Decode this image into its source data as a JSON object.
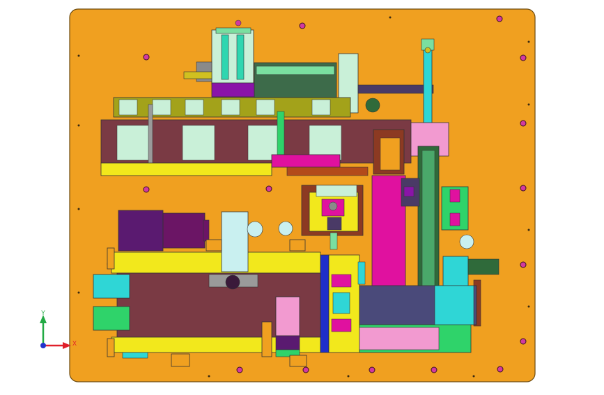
{
  "viewport": {
    "title": "",
    "colors": {
      "background": "#ffffff",
      "plate": "#f0a020",
      "plate_edge": "#6b4a10",
      "yellow": "#f2e81c",
      "magenta": "#e0119f",
      "purple": "#6b1565",
      "cyan": "#2fd6d6",
      "blue": "#1f2ec9",
      "green": "#2fd36a",
      "olive": "#a3a21a",
      "brown": "#8c3a22",
      "pink": "#f29ad0",
      "maroon": "#7a3a44"
    },
    "triad": {
      "x_label": "X",
      "y_label": "Y",
      "x_color": "#e0202a",
      "y_color": "#22aa44",
      "origin_color": "#2233cc",
      "icon": "coordinate-triad-icon"
    }
  }
}
